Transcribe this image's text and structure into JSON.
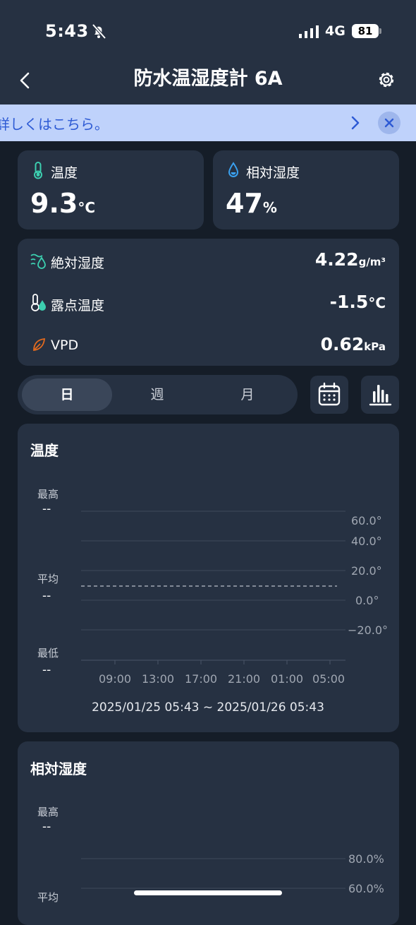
{
  "status_bar": {
    "time": "5:43",
    "network": "4G",
    "battery": "81"
  },
  "nav": {
    "title": "防水温湿度計 6A"
  },
  "banner": {
    "text": "詳しくはこちら。"
  },
  "temperature": {
    "label": "温度",
    "value": "9.3",
    "unit": "°C"
  },
  "humidity": {
    "label": "相対湿度",
    "value": "47",
    "unit": "%"
  },
  "details": [
    {
      "label": "絶対湿度",
      "value": "4.22",
      "unit": "g/m³",
      "icon": "absolute-humidity-icon",
      "color": "#3ccfb0"
    },
    {
      "label": "露点温度",
      "value": "-1.5",
      "unit": "°C",
      "icon": "dew-point-icon",
      "color": "#3ccfb0"
    },
    {
      "label": "VPD",
      "value": "0.62",
      "unit": "kPa",
      "icon": "leaf-icon",
      "color": "#e36a1e"
    }
  ],
  "tabs": [
    "日",
    "週",
    "月"
  ],
  "selected_tab": "日",
  "charts": {
    "temperature": {
      "title": "温度",
      "max_label": "最高",
      "max_value": "--",
      "avg_label": "平均",
      "avg_value": "--",
      "min_label": "最低",
      "min_value": "--",
      "y_ticks": [
        "60.0°",
        "40.0°",
        "20.0°",
        "0.0°",
        "−20.0°"
      ],
      "x_ticks": [
        "09:00",
        "13:00",
        "17:00",
        "21:00",
        "01:00",
        "05:00"
      ],
      "range": "2025/01/25 05:43 ~ 2025/01/26 05:43"
    },
    "humidity": {
      "title": "相対湿度",
      "max_label": "最高",
      "max_value": "--",
      "avg_label": "平均",
      "y_ticks": [
        "80.0%",
        "60.0%"
      ]
    }
  },
  "colors": {
    "background": "#151d28",
    "card": "#263142",
    "accent": "#3ccfb0",
    "banner": "#bfd2fb",
    "banner_text": "#2d5ad4"
  }
}
